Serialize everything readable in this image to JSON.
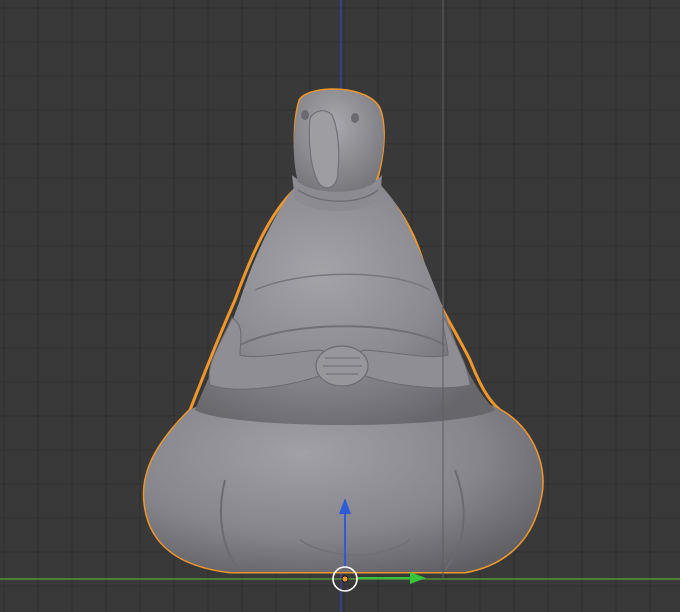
{
  "viewport": {
    "background_color": "#393939",
    "grid_color": "#2f2f2f",
    "x_axis_color": "#5aa834",
    "z_axis_color": "#3d3fb8",
    "camera_line_color": "#5e5e5e"
  },
  "object": {
    "selected": true,
    "outline_color": "#f0972c",
    "body_color": "#8d8d92"
  },
  "manipulator": {
    "up_arrow_color": "#2f5bd6",
    "right_arrow_color": "#35c43a",
    "ring_color": "#ffffff",
    "pivot_color": "#f0972c"
  }
}
